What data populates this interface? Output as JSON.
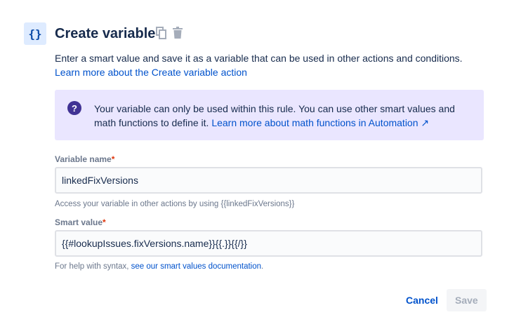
{
  "header": {
    "icon": "{}",
    "title": "Create variable",
    "copy_icon": "copy-icon",
    "delete_icon": "trash-icon"
  },
  "description": {
    "text": "Enter a smart value and save it as a variable that can be used in other actions and conditions. ",
    "link": "Learn more about the Create variable action"
  },
  "info": {
    "text": "Your variable can only be used within this rule. You can use other smart values and math functions to define it. ",
    "link": "Learn more about math functions in Automation ↗"
  },
  "variable_name": {
    "label": "Variable name",
    "required": "*",
    "value": "linkedFixVersions",
    "help": "Access your variable in other actions by using {{linkedFixVersions}}"
  },
  "smart_value": {
    "label": "Smart value",
    "required": "*",
    "value": "{{#lookupIssues.fixVersions.name}}{{.}}{{/}}",
    "help": "For help with syntax, ",
    "help_link": "see our smart values documentation",
    "help_end": "."
  },
  "buttons": {
    "cancel": "Cancel",
    "save": "Save"
  }
}
